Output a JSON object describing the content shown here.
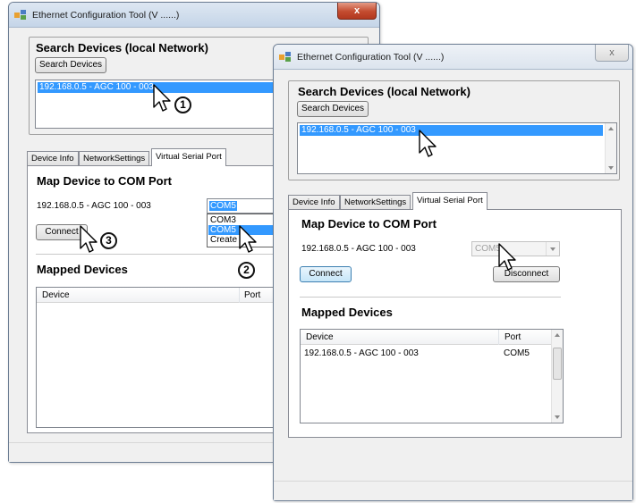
{
  "back_window": {
    "title": "Ethernet Configuration Tool (V ......)",
    "close_label": "x",
    "search_heading": "Search Devices (local Network)",
    "search_button": "Search Devices",
    "device_list": [
      "192.168.0.5 - AGC 100 - 003"
    ],
    "tabs": [
      "Device Info",
      "NetworkSettings",
      "Virtual Serial Port"
    ],
    "map_heading": "Map Device to COM Port",
    "device_label": "192.168.0.5 - AGC 100 - 003",
    "com_value": "COM5",
    "com_dropdown": [
      "COM3",
      "COM5",
      "Create C"
    ],
    "connect_button": "Connect",
    "mapped_heading": "Mapped Devices",
    "columns": [
      "Device",
      "Port"
    ]
  },
  "front_window": {
    "title": "Ethernet Configuration Tool (V ......)",
    "close_label": "x",
    "search_heading": "Search Devices (local Network)",
    "search_button": "Search Devices",
    "device_list": [
      "192.168.0.5 - AGC 100 - 003"
    ],
    "tabs": [
      "Device Info",
      "NetworkSettings",
      "Virtual Serial Port"
    ],
    "map_heading": "Map Device to COM Port",
    "device_label": "192.168.0.5 - AGC 100 - 003",
    "com_value": "COM5",
    "connect_button": "Connect",
    "disconnect_button": "Disconnect",
    "mapped_heading": "Mapped Devices",
    "columns": [
      "Device",
      "Port"
    ],
    "rows": [
      {
        "device": "192.168.0.5 - AGC 100 - 003",
        "port": "COM5"
      }
    ]
  },
  "callouts": [
    "1",
    "2",
    "3"
  ],
  "colors": {
    "selection": "#3399ff",
    "window_bg": "#f0f0f0",
    "close_active": "#c34b2f"
  }
}
